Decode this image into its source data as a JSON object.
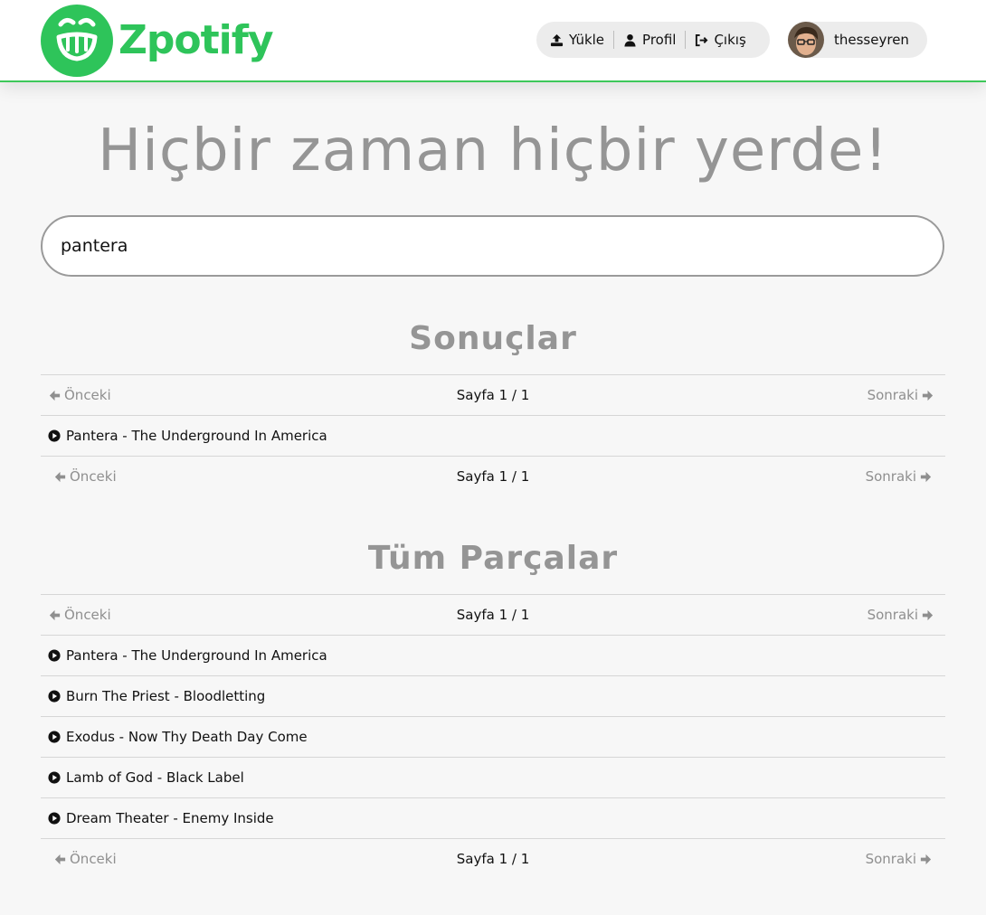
{
  "brand": {
    "name": "Zpotify",
    "color": "#2ec45a"
  },
  "nav": {
    "upload_label": "Yükle",
    "profile_label": "Profil",
    "logout_label": "Çıkış",
    "username": "thesseyren"
  },
  "hero": {
    "title": "Hiçbir zaman hiçbir yerde!"
  },
  "search": {
    "value": "pantera"
  },
  "results": {
    "title": "Sonuçlar",
    "pager": {
      "prev": "Önceki",
      "info": "Sayfa 1 / 1",
      "next": "Sonraki"
    },
    "tracks": [
      {
        "title": "Pantera - The Underground In America"
      }
    ]
  },
  "all_tracks": {
    "title": "Tüm Parçalar",
    "pager": {
      "prev": "Önceki",
      "info": "Sayfa 1 / 1",
      "next": "Sonraki"
    },
    "tracks": [
      {
        "title": "Pantera - The Underground In America"
      },
      {
        "title": "Burn The Priest - Bloodletting"
      },
      {
        "title": "Exodus - Now Thy Death Day Come"
      },
      {
        "title": "Lamb of God - Black Label"
      },
      {
        "title": "Dream Theater - Enemy Inside"
      }
    ]
  }
}
